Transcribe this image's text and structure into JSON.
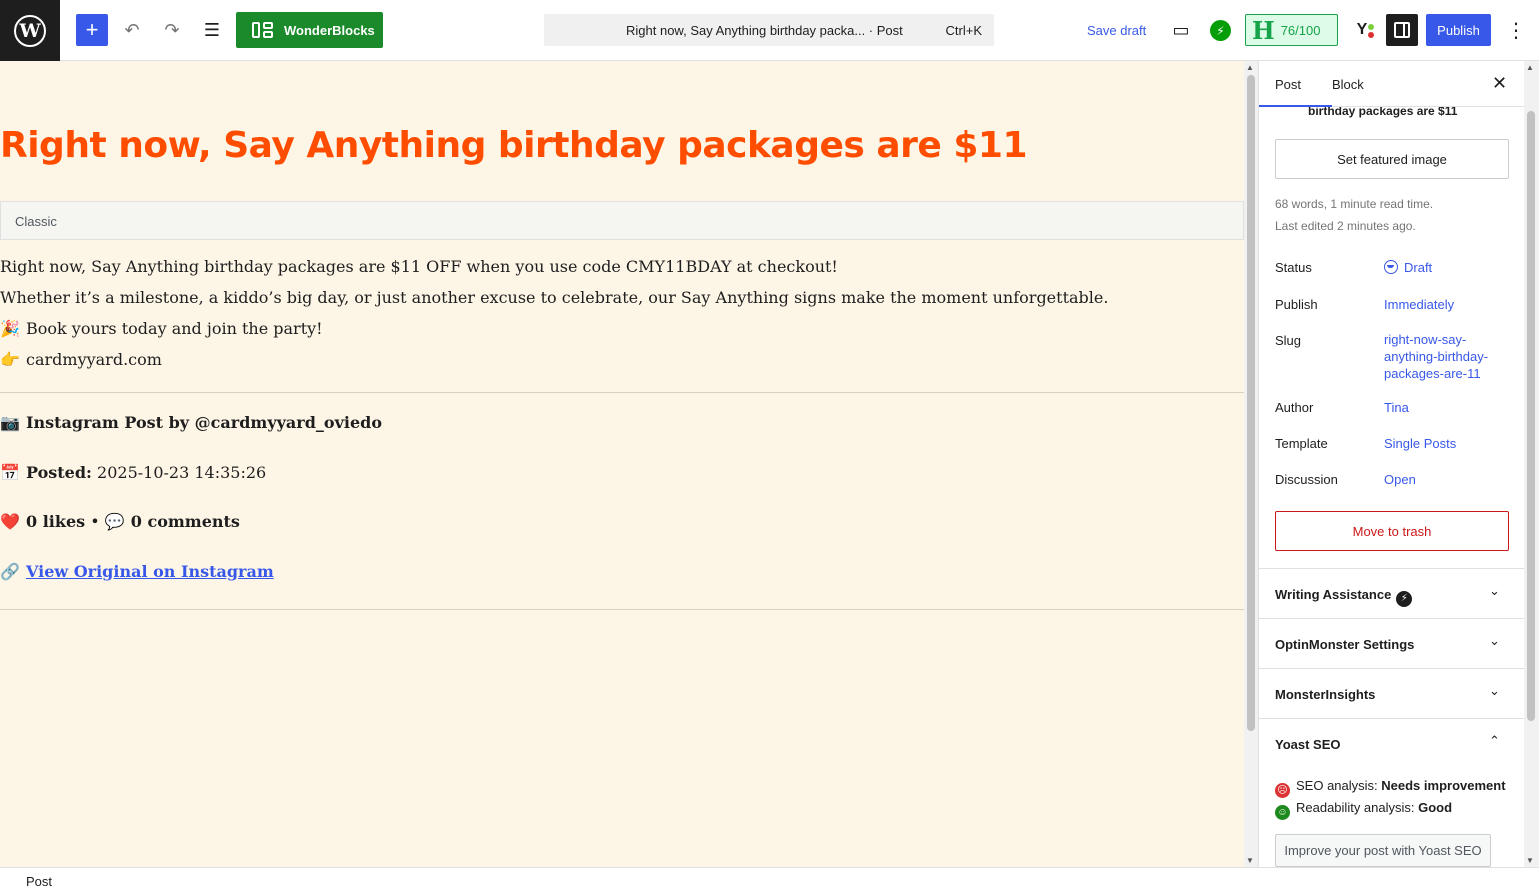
{
  "topbar": {
    "wp_logo": "W",
    "add_icon": "+",
    "undo_icon": "↶",
    "redo_icon": "↷",
    "list_icon": "☰",
    "wonderblocks_label": "WonderBlocks",
    "doc_title": "Right now, Say Anything birthday packa... · Post",
    "doc_shortcut": "Ctrl+K",
    "save_draft": "Save draft",
    "view_icon": "▭",
    "jetpack_icon": "⚡",
    "score_letter": "H",
    "score": "76/100",
    "yoast_letter": "Y",
    "publish": "Publish",
    "more_icon": "⋮"
  },
  "canvas": {
    "title": "Right now, Say Anything birthday packages are $11",
    "classic_label": "Classic",
    "paragraphs": [
      "Right now, Say Anything birthday packages are $11 OFF when you use code CMY11BDAY at checkout!",
      "Whether it’s a milestone, a kiddo’s big day, or just another excuse to celebrate, our Say Anything signs make the moment unforgettable.",
      "Book yours today and join the party!",
      "cardmyyard.com"
    ],
    "party_emoji": "🎉",
    "point_emoji": "👉",
    "instagram": {
      "camera_emoji": "📷",
      "post_by": "Instagram Post by @cardmyyard_oviedo",
      "calendar_emoji": "📅",
      "posted_label": "Posted:",
      "posted_value": " 2025-10-23 14:35:26",
      "heart_emoji": "❤️",
      "likes": "0 likes",
      "bullet": " • ",
      "speech_emoji": "💬",
      "comments": "0 comments",
      "link_emoji": "🔗",
      "view_original": "View Original on Instagram"
    }
  },
  "sidebar": {
    "tab_post": "Post",
    "tab_block": "Block",
    "close_icon": "✕",
    "cut_title": "birthday packages are $11",
    "featured_image": "Set featured image",
    "word_count": "68 words, 1 minute read time.",
    "last_edited": "Last edited 2 minutes ago.",
    "rows": [
      {
        "label": "Status",
        "value": "Draft"
      },
      {
        "label": "Publish",
        "value": "Immediately"
      },
      {
        "label": "Slug",
        "value": "right-now-say-anything-birthday-packages-are-11"
      },
      {
        "label": "Author",
        "value": "Tina"
      },
      {
        "label": "Template",
        "value": "Single Posts"
      },
      {
        "label": "Discussion",
        "value": "Open"
      }
    ],
    "slug_lines": [
      "right-now-say-",
      "anything-birthday-",
      "packages-are-11"
    ],
    "move_to_trash": "Move to trash",
    "panels": [
      {
        "title": "Writing Assistance",
        "chevron": "⌄"
      },
      {
        "title": "OptinMonster Settings",
        "chevron": "⌄"
      },
      {
        "title": "MonsterInsights",
        "chevron": "⌄"
      },
      {
        "title": "Yoast SEO",
        "chevron": "⌃"
      }
    ],
    "yoast": {
      "seo_label": "SEO analysis: ",
      "seo_value": "Needs improvement",
      "read_label": "Readability analysis: ",
      "read_value": "Good",
      "improve": "Improve your post with Yoast SEO",
      "bad_face": "☹",
      "good_face": "☺"
    }
  },
  "footer": {
    "breadcrumb": "Post"
  },
  "colors": {
    "accent": "#3858e9",
    "title": "#ff4d00",
    "wonderblocks": "#1a8a2a",
    "canvas_bg": "#fdf6e7",
    "trash": "#cc1818"
  }
}
